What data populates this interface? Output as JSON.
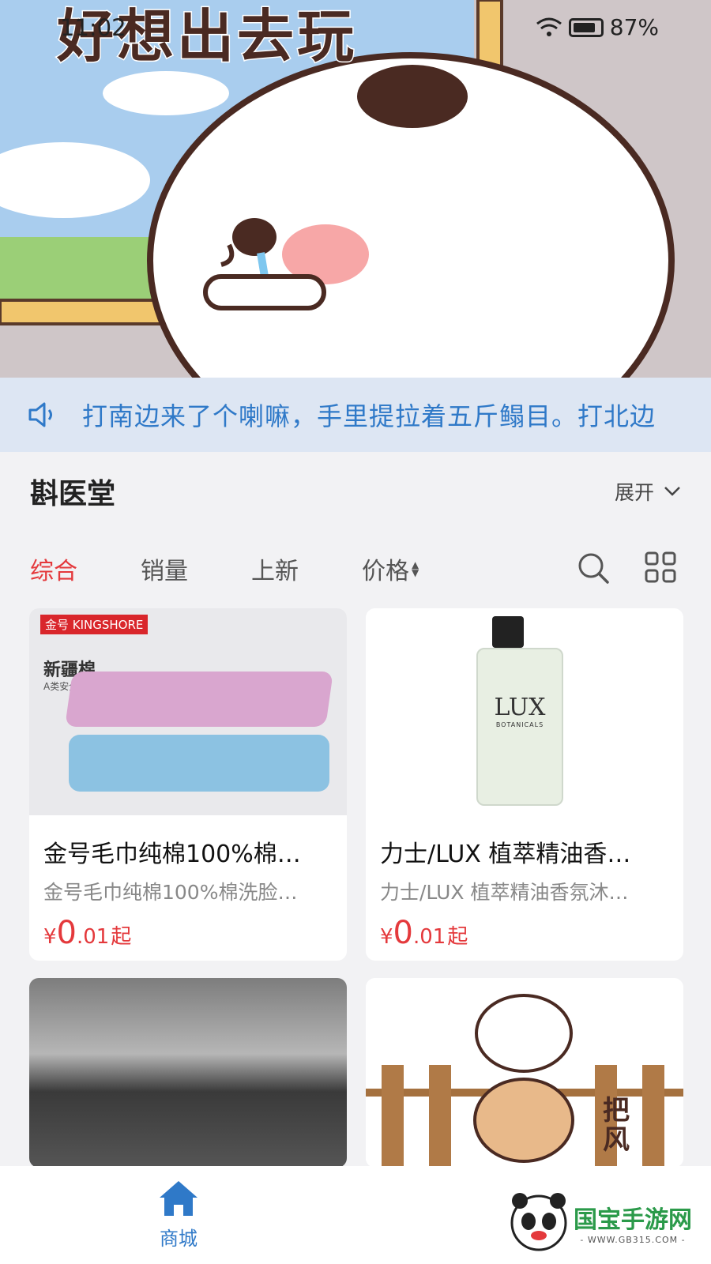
{
  "status": {
    "time": "11:02",
    "battery": "87%"
  },
  "banner": {
    "title": "好想出去玩"
  },
  "notice": {
    "text": "打南边来了个喇嘛，手里提拉着五斤鳎目。打北边"
  },
  "store": {
    "name": "斟医堂",
    "expand_label": "展开"
  },
  "tabs": [
    {
      "label": "综合",
      "active": true
    },
    {
      "label": "销量",
      "active": false
    },
    {
      "label": "上新",
      "active": false
    },
    {
      "label": "价格",
      "active": false
    }
  ],
  "products": [
    {
      "title": "金号毛巾纯棉100%棉…",
      "subtitle": "金号毛巾纯棉100%棉洗脸…",
      "price_currency": "¥",
      "price_int": "0",
      "price_dec": ".01",
      "price_suffix": "起",
      "brand": "金号 KINGSHORE",
      "badge": "新疆棉",
      "badge_sub": "A类安全标准"
    },
    {
      "title": "力士/LUX 植萃精油香…",
      "subtitle": "力士/LUX 植萃精油香氛沐…",
      "price_currency": "¥",
      "price_int": "0",
      "price_dec": ".01",
      "price_suffix": "起",
      "brand": "LUX",
      "brand_sub": "BOTANICALS"
    }
  ],
  "partial_cards": [
    {
      "sticker_text": "把风"
    }
  ],
  "bottom_nav": {
    "home_label": "商城"
  },
  "watermark": {
    "name": "国宝手游网",
    "url": "- WWW.GB315.COM -"
  },
  "colors": {
    "accent_red": "#e4393c",
    "accent_blue": "#2f79c8",
    "notice_bg": "#dde6f3"
  }
}
